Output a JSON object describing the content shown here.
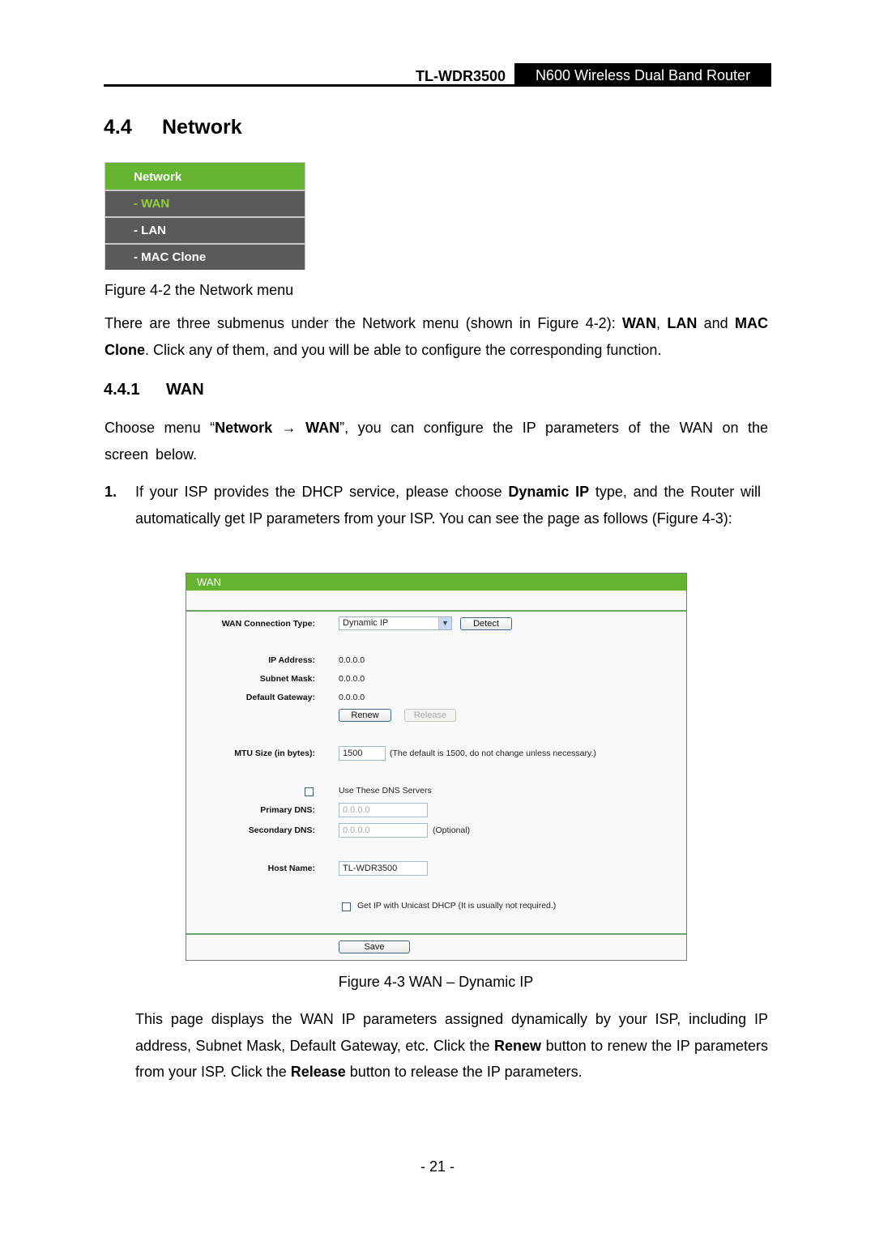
{
  "header": {
    "model": "TL-WDR3500",
    "product": "N600 Wireless Dual Band Router"
  },
  "section": {
    "number": "4.4",
    "title": "Network"
  },
  "network_menu": {
    "title": "Network",
    "items": [
      {
        "label": "- WAN",
        "active": true
      },
      {
        "label": "- LAN",
        "active": false
      },
      {
        "label": "- MAC Clone",
        "active": false
      }
    ],
    "colors": {
      "header": "#64b432",
      "item_bg": "#5a5a5a",
      "active_text": "#8ed23a"
    }
  },
  "fig_4_2_caption": "Figure 4-2 the Network menu",
  "intro_para": {
    "t1": "There are three submenus under the Network menu (shown in Figure 4-2): ",
    "b1": "WAN",
    "t2": ", ",
    "b2": "LAN",
    "t3": " and ",
    "b3": "MAC Clone",
    "t4": ". Click any of them, and you will be able to configure the corresponding function."
  },
  "subsection": {
    "number": "4.4.1",
    "title": "WAN"
  },
  "choose_para": {
    "t1": "Choose menu “",
    "b1": "Network → WAN",
    "t2": "”, you can configure the IP parameters of the WAN on the screen below."
  },
  "step1": {
    "num": "1.",
    "t1": "If your ISP provides the DHCP service, please choose ",
    "b1": "Dynamic IP",
    "t2": " type, and the Router will automatically get IP parameters from your ISP. You can see the page as follows (Figure 4-3):"
  },
  "wan_panel": {
    "title": "WAN",
    "connection_type_label": "WAN Connection Type:",
    "connection_type_value": "Dynamic IP",
    "detect_label": "Detect",
    "ip_label": "IP Address:",
    "ip_value": "0.0.0.0",
    "mask_label": "Subnet Mask:",
    "mask_value": "0.0.0.0",
    "gateway_label": "Default Gateway:",
    "gateway_value": "0.0.0.0",
    "renew_label": "Renew",
    "release_label": "Release",
    "mtu_label": "MTU Size (in bytes):",
    "mtu_value": "1500",
    "mtu_note": "(The default is 1500, do not change unless necessary.)",
    "use_dns_label": "Use These DNS Servers",
    "use_dns_checked": false,
    "primary_dns_label": "Primary DNS:",
    "primary_dns_value": "0.0.0.0",
    "secondary_dns_label": "Secondary DNS:",
    "secondary_dns_value": "0.0.0.0",
    "secondary_dns_note": "(Optional)",
    "host_name_label": "Host Name:",
    "host_name_value": "TL-WDR3500",
    "unicast_label": "Get IP with Unicast DHCP (It is usually not required.)",
    "unicast_checked": false,
    "save_label": "Save",
    "colors": {
      "title_bg": "#64b432",
      "divider": "#6aa56a"
    }
  },
  "fig_4_3_caption": "Figure 4-3 WAN – Dynamic IP",
  "desc_para": {
    "t1": "This page displays the WAN IP parameters assigned dynamically by your ISP, including IP address, Subnet Mask, Default Gateway, etc. Click the ",
    "b1": "Renew",
    "t2": " button to renew the IP parameters from your ISP. Click the ",
    "b2": "Release",
    "t3": " button to release the IP parameters."
  },
  "page_number": "- 21 -"
}
